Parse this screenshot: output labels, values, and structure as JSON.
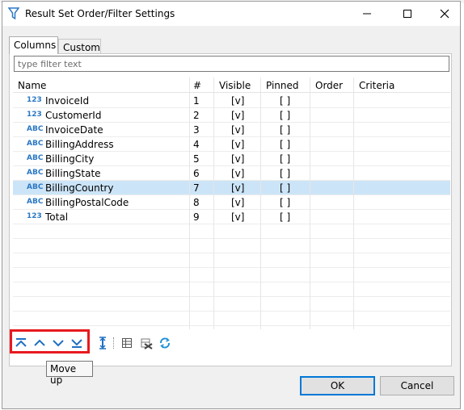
{
  "window": {
    "title": "Result Set Order/Filter Settings"
  },
  "tabs": [
    {
      "label": "Columns",
      "active": true
    },
    {
      "label": "Custom",
      "active": false
    }
  ],
  "filter": {
    "placeholder": "type filter text",
    "value": ""
  },
  "table": {
    "headers": {
      "name": "Name",
      "num": "#",
      "visible": "Visible",
      "pinned": "Pinned",
      "order": "Order",
      "criteria": "Criteria"
    },
    "rows": [
      {
        "type": "123",
        "name": "InvoiceId",
        "num": "1",
        "visible": "[v]",
        "pinned": "[ ]"
      },
      {
        "type": "123",
        "name": "CustomerId",
        "num": "2",
        "visible": "[v]",
        "pinned": "[ ]"
      },
      {
        "type": "ABC",
        "name": "InvoiceDate",
        "num": "3",
        "visible": "[v]",
        "pinned": "[ ]"
      },
      {
        "type": "ABC",
        "name": "BillingAddress",
        "num": "4",
        "visible": "[v]",
        "pinned": "[ ]"
      },
      {
        "type": "ABC",
        "name": "BillingCity",
        "num": "5",
        "visible": "[v]",
        "pinned": "[ ]"
      },
      {
        "type": "ABC",
        "name": "BillingState",
        "num": "6",
        "visible": "[v]",
        "pinned": "[ ]"
      },
      {
        "type": "ABC",
        "name": "BillingCountry",
        "num": "7",
        "visible": "[v]",
        "pinned": "[ ]"
      },
      {
        "type": "ABC",
        "name": "BillingPostalCode",
        "num": "8",
        "visible": "[v]",
        "pinned": "[ ]"
      },
      {
        "type": "123",
        "name": "Total",
        "num": "9",
        "visible": "[v]",
        "pinned": "[ ]"
      }
    ],
    "selected_row": "BillingCountry"
  },
  "toolbar": {
    "buttons": [
      {
        "name": "move-to-top-icon"
      },
      {
        "name": "move-up-icon"
      },
      {
        "name": "move-down-icon"
      },
      {
        "name": "move-to-bottom-icon"
      },
      {
        "name": "auto-size-icon"
      },
      {
        "name": "table-icon"
      },
      {
        "name": "reset-icon"
      },
      {
        "name": "refresh-icon"
      }
    ],
    "tooltip": "Move up",
    "highlight_color": "#e8191e"
  },
  "buttons": {
    "ok": "OK",
    "cancel": "Cancel"
  },
  "colors": {
    "selection": "#cce4f7",
    "type_icon": "#2b78c4",
    "accent": "#0078d7"
  }
}
